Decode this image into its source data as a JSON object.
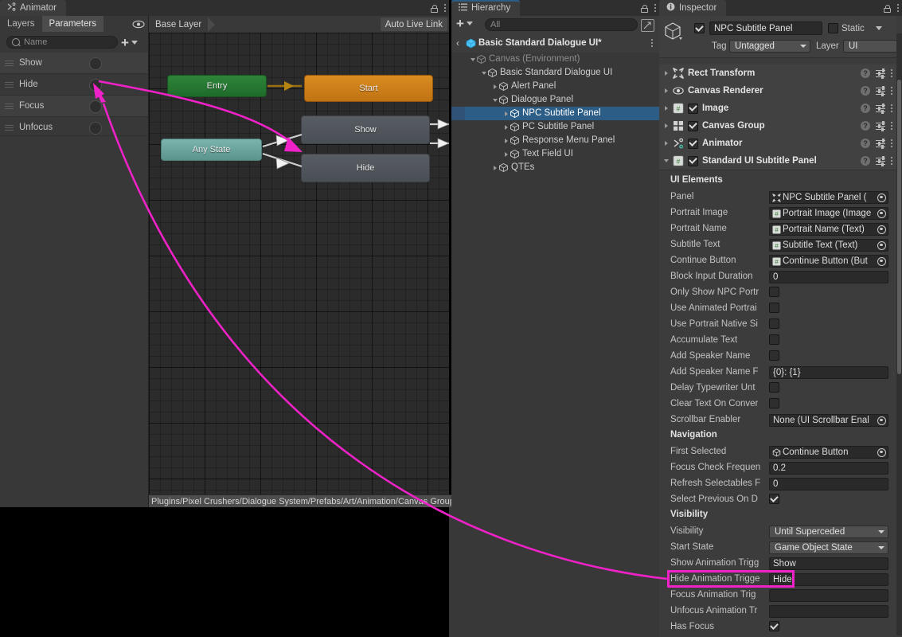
{
  "animator": {
    "tab_label": "Animator",
    "tab_icon": "animator-icon",
    "subtabs": [
      {
        "label": "Layers",
        "selected": false
      },
      {
        "label": "Parameters",
        "selected": true
      }
    ],
    "eye_icon": "eye-icon",
    "search_placeholder": "Name",
    "add_label": "+",
    "parameters": [
      {
        "name": "Show",
        "type": "trigger"
      },
      {
        "name": "Hide",
        "type": "trigger"
      },
      {
        "name": "Focus",
        "type": "trigger"
      },
      {
        "name": "Unfocus",
        "type": "trigger"
      }
    ],
    "layer_name": "Base Layer",
    "auto_live_link": "Auto Live Link",
    "asset_path": "Plugins/Pixel Crushers/Dialogue System/Prefabs/Art/Animation/Canvas Group ",
    "graph_nodes": [
      {
        "id": "entry",
        "label": "Entry",
        "color": "#2e8439"
      },
      {
        "id": "start",
        "label": "Start",
        "color": "#d98c20"
      },
      {
        "id": "any",
        "label": "Any State",
        "color": "#7bb4ad"
      },
      {
        "id": "show",
        "label": "Show",
        "color": "#585d63"
      },
      {
        "id": "hide",
        "label": "Hide",
        "color": "#585d63"
      }
    ]
  },
  "hierarchy": {
    "tab_label": "Hierarchy",
    "search_placeholder": "All",
    "breadcrumb": "Basic Standard Dialogue UI*",
    "tree": [
      {
        "label": "Canvas (Environment)",
        "indent": 1,
        "arrow": "down",
        "dim": true,
        "selected": false
      },
      {
        "label": "Basic Standard Dialogue UI",
        "indent": 2,
        "arrow": "down",
        "dim": false,
        "selected": false
      },
      {
        "label": "Alert Panel",
        "indent": 3,
        "arrow": "right",
        "dim": false,
        "selected": false
      },
      {
        "label": "Dialogue Panel",
        "indent": 3,
        "arrow": "down",
        "dim": false,
        "selected": false
      },
      {
        "label": "NPC Subtitle Panel",
        "indent": 4,
        "arrow": "right",
        "dim": false,
        "selected": true
      },
      {
        "label": "PC Subtitle Panel",
        "indent": 4,
        "arrow": "right",
        "dim": false,
        "selected": false
      },
      {
        "label": "Response Menu Panel",
        "indent": 4,
        "arrow": "right",
        "dim": false,
        "selected": false
      },
      {
        "label": "Text Field UI",
        "indent": 4,
        "arrow": "right",
        "dim": false,
        "selected": false
      },
      {
        "label": "QTEs",
        "indent": 3,
        "arrow": "right",
        "dim": false,
        "selected": false
      }
    ]
  },
  "inspector": {
    "tab_label": "Inspector",
    "object_name": "NPC Subtitle Panel",
    "object_enabled": true,
    "static_label": "Static",
    "static_checked": false,
    "tag_label": "Tag",
    "tag_value": "Untagged",
    "layer_label": "Layer",
    "layer_value": "UI",
    "components": [
      {
        "title": "Rect Transform",
        "icon": "rect-transform-icon",
        "has_checkbox": false,
        "checked": false,
        "expanded": false
      },
      {
        "title": "Canvas Renderer",
        "icon": "canvas-renderer-icon",
        "has_checkbox": false,
        "checked": false,
        "expanded": false
      },
      {
        "title": "Image",
        "icon": "script-icon",
        "has_checkbox": true,
        "checked": true,
        "expanded": false
      },
      {
        "title": "Canvas Group",
        "icon": "canvas-group-icon",
        "has_checkbox": true,
        "checked": true,
        "expanded": false
      },
      {
        "title": "Animator",
        "icon": "animator-icon",
        "has_checkbox": true,
        "checked": true,
        "expanded": false
      },
      {
        "title": "Standard UI Subtitle Panel",
        "icon": "script-icon",
        "has_checkbox": true,
        "checked": true,
        "expanded": true
      }
    ],
    "sections": [
      {
        "kind": "header",
        "label": "UI Elements"
      },
      {
        "kind": "object",
        "label": "Panel",
        "value": "NPC Subtitle Panel (",
        "icon": "rect-transform-small"
      },
      {
        "kind": "object",
        "label": "Portrait Image",
        "value": "Portrait Image (Image",
        "icon": "script-small"
      },
      {
        "kind": "object",
        "label": "Portrait Name",
        "value": "Portrait Name (Text)",
        "icon": "script-small"
      },
      {
        "kind": "object",
        "label": "Subtitle Text",
        "value": "Subtitle Text (Text)",
        "icon": "script-small"
      },
      {
        "kind": "object",
        "label": "Continue Button",
        "value": "Continue Button (But",
        "icon": "script-small"
      },
      {
        "kind": "text",
        "label": "Block Input Duration",
        "value": "0"
      },
      {
        "kind": "check",
        "label": "Only Show NPC Portr",
        "checked": false
      },
      {
        "kind": "check",
        "label": "Use Animated Portrai",
        "checked": false
      },
      {
        "kind": "check",
        "label": "Use Portrait Native Si",
        "checked": false
      },
      {
        "kind": "check",
        "label": "Accumulate Text",
        "checked": false
      },
      {
        "kind": "check",
        "label": "Add Speaker Name",
        "checked": false
      },
      {
        "kind": "text",
        "label": "Add Speaker Name F",
        "value": "{0}: {1}"
      },
      {
        "kind": "check",
        "label": "Delay Typewriter Unt",
        "checked": false
      },
      {
        "kind": "check",
        "label": "Clear Text On Conver",
        "checked": false
      },
      {
        "kind": "object",
        "label": "Scrollbar Enabler",
        "value": "None (UI Scrollbar Enal",
        "icon": "none"
      },
      {
        "kind": "header",
        "label": "Navigation"
      },
      {
        "kind": "object",
        "label": "First Selected",
        "value": "Continue Button",
        "icon": "cube-small"
      },
      {
        "kind": "text",
        "label": "Focus Check Frequen",
        "value": "0.2"
      },
      {
        "kind": "text",
        "label": "Refresh Selectables F",
        "value": "0"
      },
      {
        "kind": "check",
        "label": "Select Previous On D",
        "checked": true
      },
      {
        "kind": "header",
        "label": "Visibility"
      },
      {
        "kind": "dropdown",
        "label": "Visibility",
        "value": "Until Superceded"
      },
      {
        "kind": "dropdown",
        "label": "Start State",
        "value": "Game Object State"
      },
      {
        "kind": "text",
        "label": "Show Animation Trigg",
        "value": "Show"
      },
      {
        "kind": "text",
        "label": "Hide Animation Trigge",
        "value": "Hide",
        "highlight": true
      },
      {
        "kind": "text",
        "label": "Focus Animation Trig",
        "value": ""
      },
      {
        "kind": "text",
        "label": "Unfocus Animation Tr",
        "value": ""
      },
      {
        "kind": "check",
        "label": "Has Focus",
        "checked": true
      }
    ]
  },
  "annotation": {
    "highlight_color": "#ef22c8",
    "note": "Hide Animation Trigger linked to Hide parameter"
  }
}
